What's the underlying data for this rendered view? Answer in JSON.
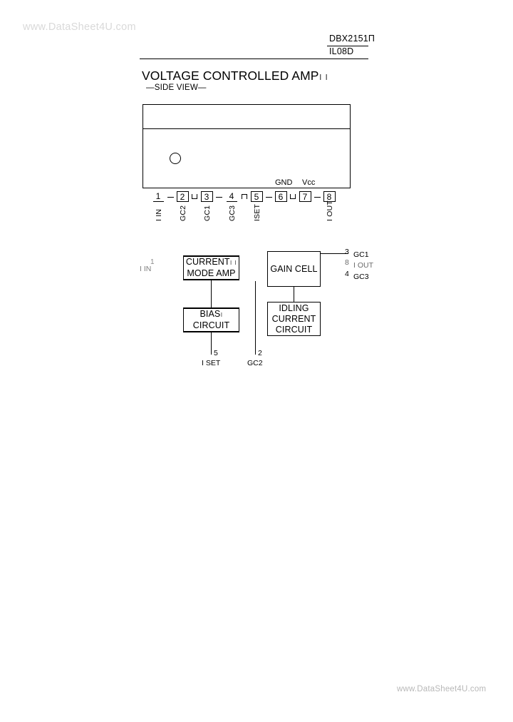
{
  "page": {
    "watermark_top": "www.DataSheet4U.com",
    "watermark_bottom": "www.DataSheet4U.com"
  },
  "header": {
    "part_number": "DBX2151",
    "part_number_artifact": "Π",
    "package_code": "IL08D"
  },
  "title": {
    "main": "VOLTAGE CONTROLLED AMP",
    "main_artifact": "ı ı",
    "subtitle": "—SIDE VIEW—"
  },
  "package": {
    "label_gnd": "GND",
    "label_vcc": "Vcc",
    "pins": [
      {
        "number": "1",
        "label": "I IN",
        "boxed": false
      },
      {
        "number": "2",
        "label": "GC2",
        "boxed": true
      },
      {
        "number": "3",
        "label": "GC1",
        "boxed": true
      },
      {
        "number": "4",
        "label": "GC3",
        "boxed": false
      },
      {
        "number": "5",
        "label": "ISET",
        "boxed": true
      },
      {
        "number": "6",
        "label": "",
        "boxed": true
      },
      {
        "number": "7",
        "label": "",
        "boxed": true
      },
      {
        "number": "8",
        "label": "I OUT",
        "boxed": true
      }
    ]
  },
  "block_diagram": {
    "input": {
      "pin": "1",
      "label": "I IN"
    },
    "blocks": {
      "current_mode_amp_line1": "CURRENT",
      "current_mode_amp_line1_artifact": "ı ı",
      "current_mode_amp_line2": "MODE AMP",
      "bias_circuit_line1": "BIAS",
      "bias_circuit_line1_artifact": "ı",
      "bias_circuit_line2": "CIRCUIT",
      "gain_cell": "GAIN CELL",
      "idling_line1": "IDLING",
      "idling_line2": "CURRENT",
      "idling_line3": "CIRCUIT"
    },
    "outputs": [
      {
        "pin": "3",
        "label": "GC1"
      },
      {
        "pin": "8",
        "label": "I OUT"
      },
      {
        "pin": "4",
        "label": "GC3"
      }
    ],
    "bottom_pins": [
      {
        "pin": "5",
        "label": "I SET"
      },
      {
        "pin": "2",
        "label": "GC2"
      }
    ]
  }
}
